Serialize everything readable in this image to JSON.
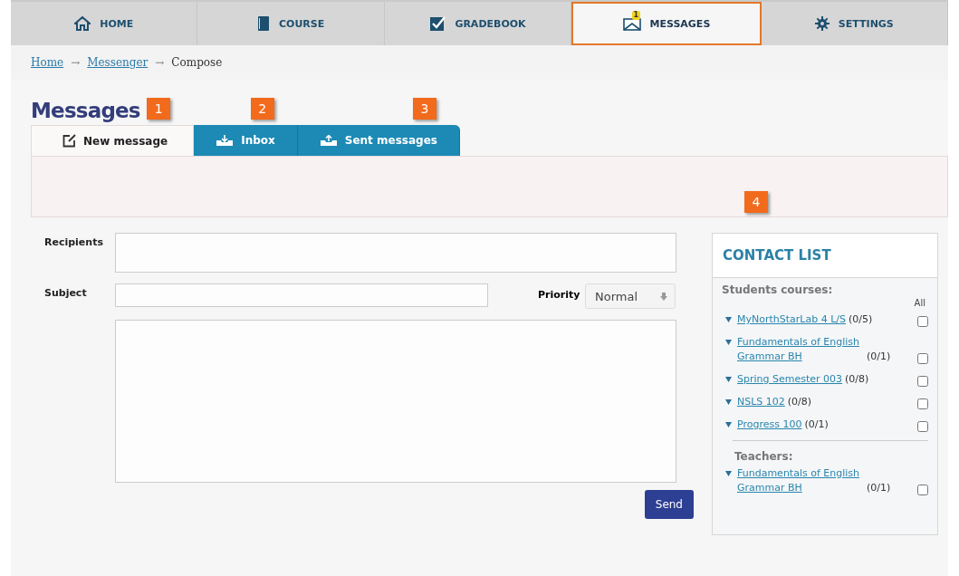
{
  "nav": [
    {
      "label": "HOME",
      "selected": false
    },
    {
      "label": "COURSE",
      "selected": false
    },
    {
      "label": "GRADEBOOK",
      "selected": false
    },
    {
      "label": "MESSAGES",
      "selected": true,
      "badge": "1"
    },
    {
      "label": "SETTINGS",
      "selected": false
    }
  ],
  "breadcrumb": [
    {
      "label": "Home",
      "link": true
    },
    {
      "label": "Messenger",
      "link": true
    },
    {
      "label": "Compose",
      "link": false
    }
  ],
  "breadcrumb_separator": "→",
  "title": "Messages",
  "tabs": [
    {
      "label": "New message",
      "selected": true,
      "callout": "1"
    },
    {
      "label": "Inbox",
      "selected": false,
      "callout": "2"
    },
    {
      "label": "Sent messages",
      "selected": false,
      "callout": "3"
    }
  ],
  "form": {
    "recipients_label": "Recipients",
    "subject_label": "Subject",
    "priority_label": "Priority",
    "priority_value": "Normal",
    "send": "Send"
  },
  "contacts": {
    "title": "CONTACT LIST",
    "callout": "4",
    "all_label": "All",
    "groups": [
      {
        "title": "Students courses:",
        "items": [
          {
            "name": "MyNorthStarLab 4 L/S",
            "count": "(0/5)",
            "checked": false
          },
          {
            "name": "Fundamentals of English Grammar BH",
            "count": "(0/1)",
            "checked": false
          },
          {
            "name": "Spring Semester 003",
            "count": "(0/8)",
            "checked": false
          },
          {
            "name": "NSLS 102",
            "count": "(0/8)",
            "checked": false
          },
          {
            "name": "Progress 100",
            "count": "(0/1)",
            "checked": false
          }
        ]
      },
      {
        "title": "Teachers:",
        "items": [
          {
            "name": "Fundamentals of English Grammar BH",
            "count": "(0/1)",
            "checked": false
          }
        ]
      }
    ]
  }
}
